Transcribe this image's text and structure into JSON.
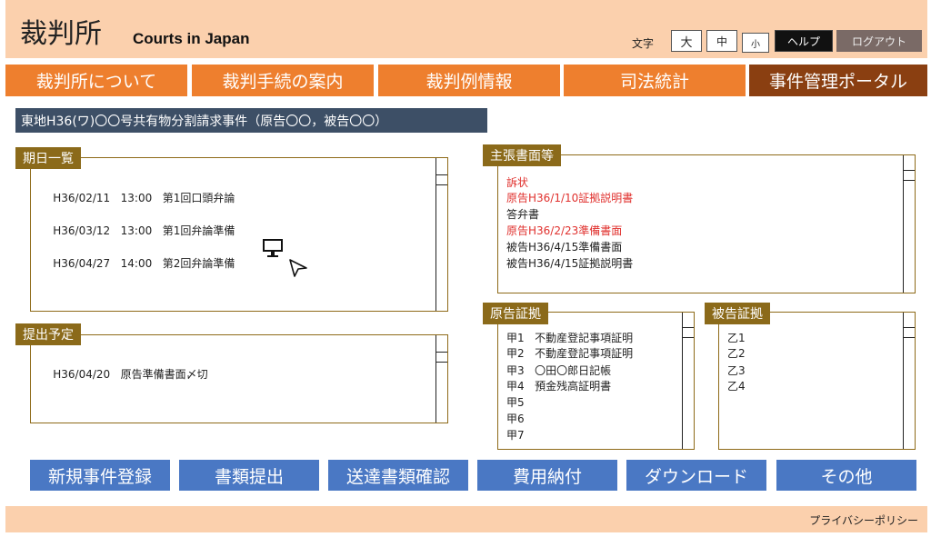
{
  "header": {
    "logo_jp": "裁判所",
    "logo_en": "Courts in Japan",
    "font_size_label": "文字",
    "font_large": "大",
    "font_medium": "中",
    "font_small": "小",
    "help": "ヘルプ",
    "logout": "ログアウト"
  },
  "nav": {
    "tabs": [
      {
        "label": "裁判所について"
      },
      {
        "label": "裁判手続の案内"
      },
      {
        "label": "裁判例情報"
      },
      {
        "label": "司法統計"
      },
      {
        "label": "事件管理ポータル"
      }
    ]
  },
  "case_title": "東地H36(ワ)〇〇号共有物分割請求事件（原告〇〇，被告〇〇）",
  "schedule": {
    "label": "期日一覧",
    "items": [
      {
        "date": "H36/02/11",
        "time": "13:00",
        "event": "第1回口頭弁論"
      },
      {
        "date": "H36/03/12",
        "time": "13:00",
        "event": "第1回弁論準備"
      },
      {
        "date": "H36/04/27",
        "time": "14:00",
        "event": "第2回弁論準備"
      }
    ]
  },
  "submission": {
    "label": "提出予定",
    "items": [
      {
        "date": "H36/04/20",
        "text": "原告準備書面〆切"
      }
    ]
  },
  "briefs": {
    "label": "主張書面等",
    "items": [
      {
        "text": "訴状",
        "highlight": true
      },
      {
        "text": "原告H36/1/10証拠説明書",
        "highlight": true
      },
      {
        "text": "答弁書",
        "highlight": false
      },
      {
        "text": "原告H36/2/23準備書面",
        "highlight": true
      },
      {
        "text": "被告H36/4/15準備書面",
        "highlight": false
      },
      {
        "text": "被告H36/4/15証拠説明書",
        "highlight": false
      }
    ]
  },
  "plaintiff_evidence": {
    "label": "原告証拠",
    "items": [
      {
        "id": "甲1",
        "text": "不動産登記事項証明"
      },
      {
        "id": "甲2",
        "text": "不動産登記事項証明"
      },
      {
        "id": "甲3",
        "text": "〇田〇郎日記帳"
      },
      {
        "id": "甲4",
        "text": "預金残高証明書"
      },
      {
        "id": "甲5",
        "text": ""
      },
      {
        "id": "甲6",
        "text": ""
      },
      {
        "id": "甲7",
        "text": ""
      }
    ]
  },
  "defendant_evidence": {
    "label": "被告証拠",
    "items": [
      {
        "id": "乙1"
      },
      {
        "id": "乙2"
      },
      {
        "id": "乙3"
      },
      {
        "id": "乙4"
      }
    ]
  },
  "actions": [
    {
      "label": "新規事件登録"
    },
    {
      "label": "書類提出"
    },
    {
      "label": "送達書類確認"
    },
    {
      "label": "費用納付"
    },
    {
      "label": "ダウンロード"
    },
    {
      "label": "その他"
    }
  ],
  "footer": {
    "privacy": "プライバシーポリシー"
  },
  "icons": {
    "monitor": "monitor-icon",
    "cursor": "cursor-icon"
  },
  "colors": {
    "header_bg": "#fbd0ad",
    "nav_tab": "#ee7f2e",
    "nav_active": "#8a3f11",
    "panel_label": "#8b6a1a",
    "case_bar": "#3d4f66",
    "action_button": "#4a78c4",
    "highlight_text": "#e0302d"
  }
}
